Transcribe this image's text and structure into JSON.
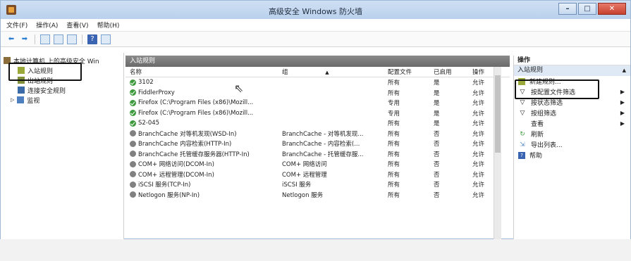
{
  "window": {
    "title": "高级安全 Windows 防火墙",
    "min": "–",
    "max": "□",
    "close": "✕"
  },
  "menu": [
    "文件(F)",
    "操作(A)",
    "查看(V)",
    "帮助(H)"
  ],
  "tree": {
    "root": "本地计算机 上的高级安全 Win",
    "items": [
      "入站规则",
      "出站规则",
      "连接安全规则",
      "监视"
    ]
  },
  "center": {
    "panel_title": "入站规则",
    "columns": [
      "名称",
      "组",
      "配置文件",
      "已启用",
      "操作"
    ],
    "rows": [
      {
        "name": "3102",
        "group": "",
        "profile": "所有",
        "enabled": "是",
        "action": "允许",
        "on": true
      },
      {
        "name": "FiddlerProxy",
        "group": "",
        "profile": "所有",
        "enabled": "是",
        "action": "允许",
        "on": true
      },
      {
        "name": "Firefox (C:\\Program Files (x86)\\Mozill...",
        "group": "",
        "profile": "专用",
        "enabled": "是",
        "action": "允许",
        "on": true
      },
      {
        "name": "Firefox (C:\\Program Files (x86)\\Mozill...",
        "group": "",
        "profile": "专用",
        "enabled": "是",
        "action": "允许",
        "on": true
      },
      {
        "name": "S2-045",
        "group": "",
        "profile": "所有",
        "enabled": "是",
        "action": "允许",
        "on": true
      },
      {
        "name": "BranchCache 对等机发现(WSD-In)",
        "group": "BranchCache - 对等机发现...",
        "profile": "所有",
        "enabled": "否",
        "action": "允许",
        "on": false
      },
      {
        "name": "BranchCache 内容检索(HTTP-In)",
        "group": "BranchCache - 内容检索(...",
        "profile": "所有",
        "enabled": "否",
        "action": "允许",
        "on": false
      },
      {
        "name": "BranchCache 托管缓存服务器(HTTP-In)",
        "group": "BranchCache - 托管缓存服...",
        "profile": "所有",
        "enabled": "否",
        "action": "允许",
        "on": false
      },
      {
        "name": "COM+ 网络访问(DCOM-In)",
        "group": "COM+ 网络访问",
        "profile": "所有",
        "enabled": "否",
        "action": "允许",
        "on": false
      },
      {
        "name": "COM+ 远程管理(DCOM-In)",
        "group": "COM+ 远程管理",
        "profile": "所有",
        "enabled": "否",
        "action": "允许",
        "on": false
      },
      {
        "name": "iSCSI 服务(TCP-In)",
        "group": "iSCSI 服务",
        "profile": "所有",
        "enabled": "否",
        "action": "允许",
        "on": false
      },
      {
        "name": "Netlogon 服务(NP-In)",
        "group": "Netlogon 服务",
        "profile": "所有",
        "enabled": "否",
        "action": "允许",
        "on": false
      }
    ]
  },
  "actions": {
    "title": "操作",
    "section": "入站规则",
    "items": [
      "新建规则...",
      "按配置文件筛选",
      "按状态筛选",
      "按组筛选",
      "查看",
      "刷新",
      "导出列表...",
      "帮助"
    ]
  }
}
